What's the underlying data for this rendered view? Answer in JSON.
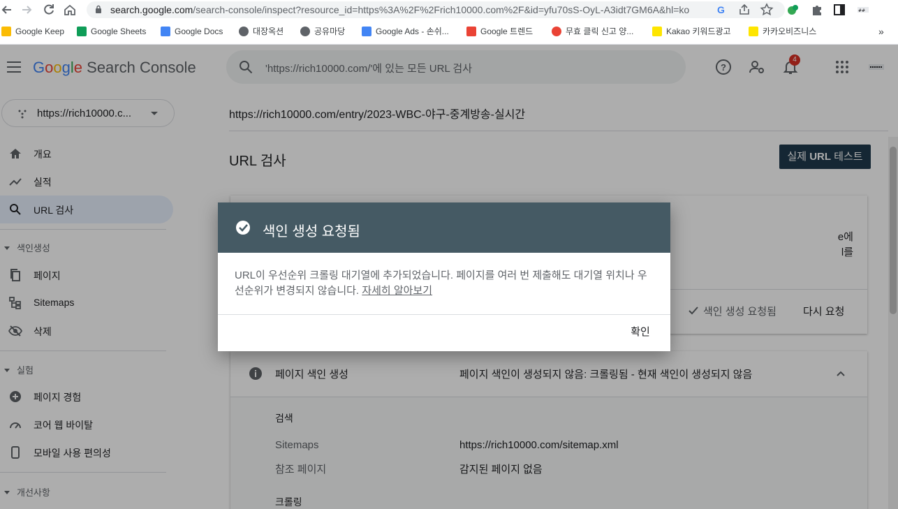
{
  "browser": {
    "url_host": "search.google.com",
    "url_path": "/search-console/inspect?resource_id=https%3A%2F%2Frich10000.com%2F&id=yfu70sS-OyL-A3idt7GM6A&hl=ko",
    "bookmarks": [
      {
        "label": "Google Keep",
        "color": "#fbbc04"
      },
      {
        "label": "Google Sheets",
        "color": "#0f9d58"
      },
      {
        "label": "Google Docs",
        "color": "#4285f4"
      },
      {
        "label": "대장옥션",
        "color": "#5f6368"
      },
      {
        "label": "공유마당",
        "color": "#5f6368"
      },
      {
        "label": "Google Ads - 손쉬...",
        "color": "#4285f4"
      },
      {
        "label": "Google 트렌드",
        "color": "#ea4335"
      },
      {
        "label": "무효 클릭 신고 양...",
        "color": "#ea4335"
      },
      {
        "label": "Kakao 키워드광고",
        "color": "#fee500"
      },
      {
        "label": "카카오비즈니스",
        "color": "#fee500"
      }
    ]
  },
  "appbar": {
    "logo_google": "Google",
    "logo_product": "Search Console",
    "search_placeholder": "'https://rich10000.com/'에 있는 모든 URL 검사",
    "notification_count": "4"
  },
  "sidebar": {
    "property": "https://rich10000.c...",
    "items": [
      {
        "label": "개요",
        "icon": "home-icon"
      },
      {
        "label": "실적",
        "icon": "trending-up-icon"
      },
      {
        "label": "URL 검사",
        "icon": "search-icon"
      }
    ],
    "section_indexing": "색인생성",
    "indexing_items": [
      {
        "label": "페이지",
        "icon": "pages-icon"
      },
      {
        "label": "Sitemaps",
        "icon": "sitemap-icon"
      },
      {
        "label": "삭제",
        "icon": "eye-off-icon"
      }
    ],
    "section_experience": "실험",
    "experience_items": [
      {
        "label": "페이지 경험",
        "icon": "plus-circle-icon"
      },
      {
        "label": "코어 웹 바이탈",
        "icon": "speed-icon"
      },
      {
        "label": "모바일 사용 편의성",
        "icon": "phone-icon"
      }
    ],
    "section_enhancements": "개선사항"
  },
  "main": {
    "inspected_url": "https://rich10000.com/entry/2023-WBC-야구-중계방송-실시간",
    "page_title": "URL 검사",
    "live_test_prefix": "실제 ",
    "live_test_bold": "URL",
    "live_test_suffix": " 테스트",
    "card_fragment_1": "e에",
    "card_fragment_2": "l를",
    "index_requested_status": "색인 생성 요청됨",
    "request_again": "다시 요청",
    "indexing_title": "페이지 색인 생성",
    "indexing_status": "페이지 색인이 생성되지 않음: 크롤링됨 - 현재 색인이 생성되지 않음",
    "discovery_heading": "검색",
    "sitemaps_label": "Sitemaps",
    "sitemaps_value": "https://rich10000.com/sitemap.xml",
    "referring_label": "참조 페이지",
    "referring_value": "감지된 페이지 없음",
    "crawl_heading": "크롤링"
  },
  "dialog": {
    "title": "색인 생성 요청됨",
    "body": "URL이 우선순위 크롤링 대기열에 추가되었습니다. 페이지를 여러 번 제출해도 대기열 위치나 우선순위가 변경되지 않습니다. ",
    "link": "자세히 알아보기",
    "ok": "확인"
  }
}
